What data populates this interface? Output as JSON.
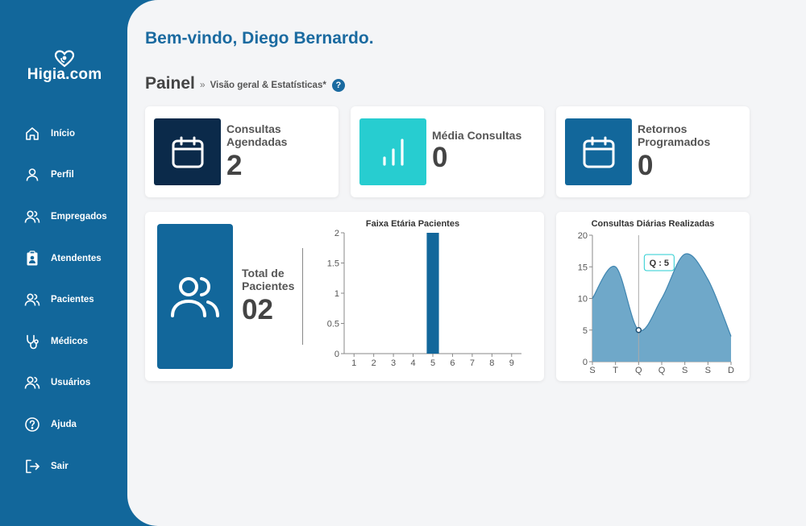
{
  "sidebar": {
    "logo_text": "Higia.com",
    "items": [
      {
        "label": "Início",
        "icon": "home-icon"
      },
      {
        "label": "Perfil",
        "icon": "user-icon"
      },
      {
        "label": "Empregados",
        "icon": "users-icon"
      },
      {
        "label": "Atendentes",
        "icon": "clipboard-user-icon"
      },
      {
        "label": "Pacientes",
        "icon": "users-icon"
      },
      {
        "label": "Médicos",
        "icon": "stethoscope-icon"
      },
      {
        "label": "Usuários",
        "icon": "users-icon"
      },
      {
        "label": "Ajuda",
        "icon": "help-circle-icon"
      },
      {
        "label": "Sair",
        "icon": "logout-icon"
      }
    ]
  },
  "header": {
    "welcome": "Bem-vindo, Diego Bernardo.",
    "title": "Painel",
    "separator": "»",
    "subtitle": "Visão geral & Estatísticas*",
    "help_glyph": "?"
  },
  "stats": [
    {
      "label": "Consultas Agendadas",
      "value": "2",
      "color": "#0b2a4a",
      "icon": "calendar-icon"
    },
    {
      "label": "Média Consultas",
      "value": "0",
      "color": "#27cdd0",
      "icon": "bar-chart-icon"
    },
    {
      "label": "Retornos Programados",
      "value": "0",
      "color": "#12679b",
      "icon": "calendar-icon"
    }
  ],
  "patients": {
    "label": "Total de Pacientes",
    "value": "02",
    "color": "#12679b",
    "icon": "users-icon"
  },
  "chart_data": [
    {
      "type": "bar",
      "title": "Faixa Etária Pacientes",
      "categories": [
        "1",
        "2",
        "3",
        "4",
        "5",
        "6",
        "7",
        "8",
        "9"
      ],
      "values": [
        0,
        0,
        0,
        0,
        2,
        0,
        0,
        0,
        0
      ],
      "ylim": [
        0,
        2
      ],
      "yticks": [
        "0",
        "0.5",
        "1",
        "1.5",
        "2"
      ],
      "color": "#12679b"
    },
    {
      "type": "area",
      "title": "Consultas Diárias Realizadas",
      "categories": [
        "S",
        "T",
        "Q",
        "Q",
        "S",
        "S",
        "D"
      ],
      "values": [
        10,
        15,
        5,
        10,
        17,
        13,
        4
      ],
      "ylim": [
        0,
        20
      ],
      "yticks": [
        "0",
        "5",
        "10",
        "15",
        "20"
      ],
      "tooltip": "Q : 5",
      "tooltip_index": 2,
      "color": "#6fa8c9",
      "line_color": "#3f85b0"
    }
  ]
}
